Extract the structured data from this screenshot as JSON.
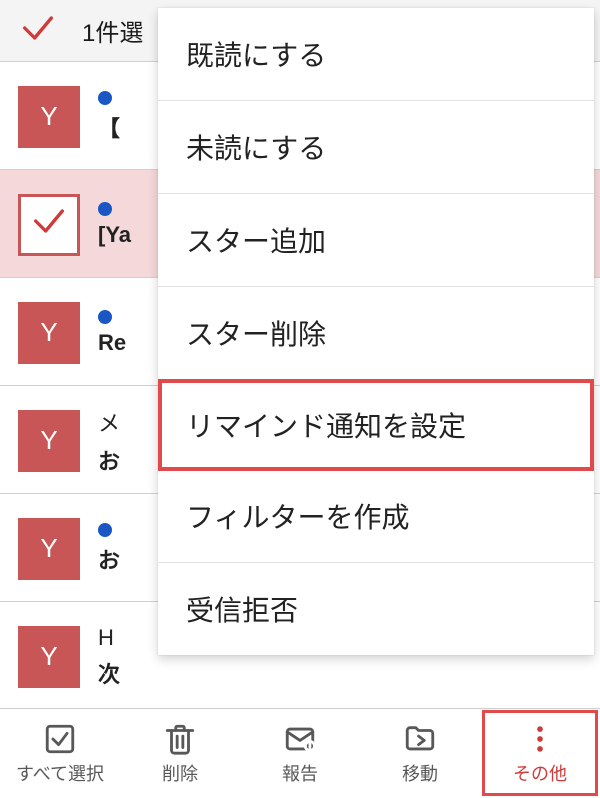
{
  "colors": {
    "accent": "#cf3a3a",
    "unread_dot": "#1b57c4"
  },
  "header": {
    "selection_count_text": "1件選"
  },
  "mail_rows": [
    {
      "avatar": "Y",
      "selected": false,
      "unread": true,
      "line1": "",
      "line2": "【"
    },
    {
      "avatar": "Y",
      "selected": true,
      "unread": true,
      "line1": "",
      "line2": "[Ya"
    },
    {
      "avatar": "Y",
      "selected": false,
      "unread": true,
      "line1": "",
      "line2": "Re"
    },
    {
      "avatar": "Y",
      "selected": false,
      "unread": false,
      "line1": "メ",
      "line2": "お"
    },
    {
      "avatar": "Y",
      "selected": false,
      "unread": true,
      "line1": "",
      "line2": "お"
    },
    {
      "avatar": "Y",
      "selected": false,
      "unread": false,
      "line1": "H",
      "line2": "次"
    }
  ],
  "menu": {
    "items": [
      {
        "label": "既読にする",
        "highlight": false
      },
      {
        "label": "未読にする",
        "highlight": false
      },
      {
        "label": "スター追加",
        "highlight": false
      },
      {
        "label": "スター削除",
        "highlight": false
      },
      {
        "label": "リマインド通知を設定",
        "highlight": true
      },
      {
        "label": "フィルターを作成",
        "highlight": false
      },
      {
        "label": "受信拒否",
        "highlight": false
      }
    ]
  },
  "toolbar": {
    "select_all": "すべて選択",
    "delete": "削除",
    "report": "報告",
    "move": "移動",
    "more": "その他"
  }
}
